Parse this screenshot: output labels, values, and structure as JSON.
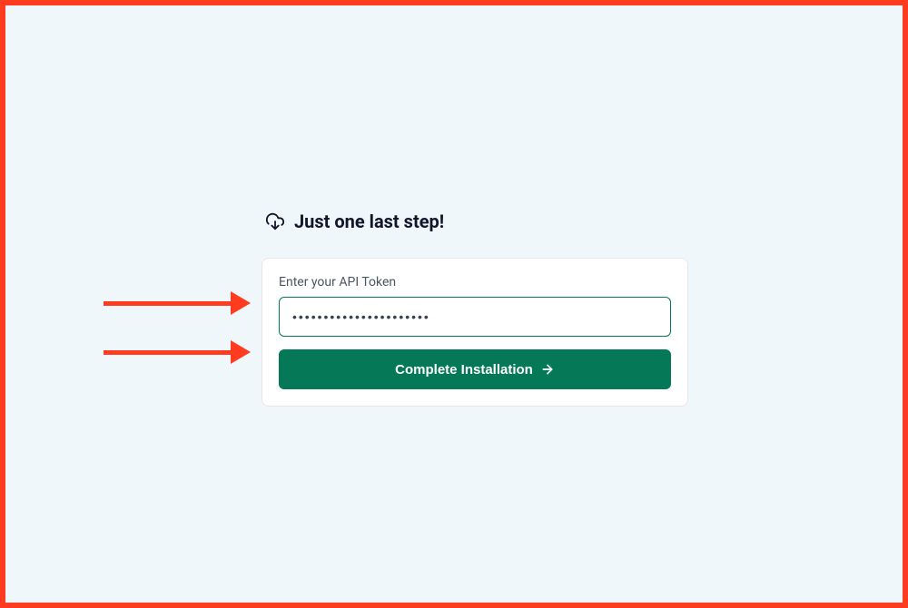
{
  "heading": {
    "title": "Just one last step!"
  },
  "form": {
    "label": "Enter your API Token",
    "token_value": "••••••••••••••••••••••",
    "submit_label": "Complete Installation"
  },
  "colors": {
    "accent_green": "#047857",
    "annotation_red": "#ff3c1f",
    "page_bg": "#f0f7fa"
  }
}
